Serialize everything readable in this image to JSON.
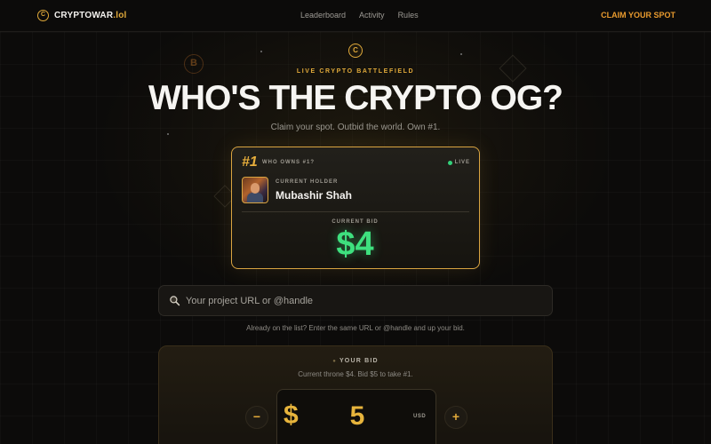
{
  "colors": {
    "accent": "#e0a93a",
    "cta": "#e89a2e",
    "bid_green": "#3ee07e",
    "live_green": "#33d17a",
    "background": "#0c0b0a"
  },
  "nav": {
    "brand_name": "CRYPTOWAR",
    "brand_tld": ".lol",
    "brand_icon": "C",
    "links": [
      {
        "label": "Leaderboard"
      },
      {
        "label": "Activity"
      },
      {
        "label": "Rules"
      }
    ],
    "cta_label": "CLAIM YOUR SPOT"
  },
  "hero": {
    "icon": "C",
    "eyebrow": "LIVE CRYPTO BATTLEFIELD",
    "headline": "WHO'S THE CRYPTO OG?",
    "subline": "Claim your spot. Outbid the world. Own #1.",
    "decor_coin": "B"
  },
  "card": {
    "rank": "#1",
    "caption": "WHO OWNS #1?",
    "live_label": "LIVE",
    "holder_label": "CURRENT HOLDER",
    "holder_name": "Mubashir Shah",
    "bid_label": "CURRENT BID",
    "bid_amount": "$4"
  },
  "search": {
    "placeholder": "Your project URL or @handle",
    "value": "",
    "hint": "Already on the list? Enter the same URL or @handle and up your bid."
  },
  "bid_panel": {
    "title": "YOUR BID",
    "subtitle": "Current throne $4. Bid $5 to take #1.",
    "minus_label": "−",
    "plus_label": "+",
    "currency_symbol": "$",
    "amount": "5",
    "unit": "USD"
  }
}
